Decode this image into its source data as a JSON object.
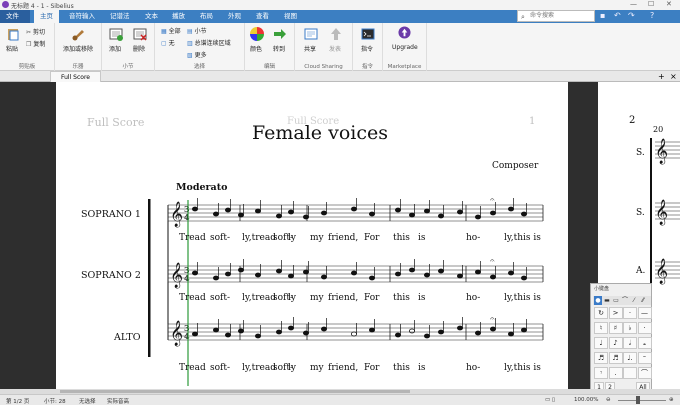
{
  "window": {
    "title": "无标题 4 - 1 - Sibelius",
    "controls": [
      "—",
      "☐",
      "✕"
    ]
  },
  "ribbon_tabs": [
    "文件",
    "主页",
    "音符输入",
    "记谱法",
    "文本",
    "播放",
    "布局",
    "外观",
    "查看",
    "视图"
  ],
  "search": {
    "placeholder": "命令搜索"
  },
  "ribbon": {
    "groups": [
      {
        "label": "剪贴板",
        "buttons": [
          "粘贴",
          "剪切",
          "复制"
        ]
      },
      {
        "label": "乐器",
        "buttons": [
          "添加或移除"
        ]
      },
      {
        "label": "小节",
        "buttons": [
          "添加",
          "删除"
        ]
      },
      {
        "label": "选择",
        "buttons": [
          "全部",
          "无",
          "小节",
          "总谱连续区域",
          "更多"
        ]
      },
      {
        "label": "编辑",
        "buttons": [
          "颜色",
          "转到"
        ]
      },
      {
        "label": "Cloud Sharing",
        "buttons": [
          "共享",
          "发表"
        ]
      },
      {
        "label": "指令",
        "buttons": [
          "指令"
        ]
      },
      {
        "label": "Marketplace",
        "buttons": [
          "Upgrade"
        ]
      }
    ]
  },
  "doc_tab": {
    "label": "Full Score"
  },
  "score": {
    "header_left": "Full Score",
    "header_center": "Full Score",
    "page_number": "1",
    "title": "Female voices",
    "composer": "Composer",
    "tempo": "Moderato",
    "staves": [
      "SOPRANO 1",
      "SOPRANO 2",
      "ALTO"
    ],
    "lyrics": [
      "Tread",
      "soft-",
      "ly,tread",
      "soft-",
      "ly",
      "my",
      "friend,",
      "For",
      "this",
      "is",
      "ho-",
      "ly,this is"
    ]
  },
  "page2": {
    "page_number": "2",
    "bar_number": "20",
    "labels": [
      "S.",
      "S.",
      "A."
    ]
  },
  "keypad": {
    "title": "小键盘",
    "bottom": [
      "1",
      "2",
      "All"
    ]
  },
  "status": {
    "page": "第 1/2 页",
    "bar": "小节: 28",
    "selection": "无选择",
    "pitch": "实际音高",
    "zoom": "100.00%"
  }
}
